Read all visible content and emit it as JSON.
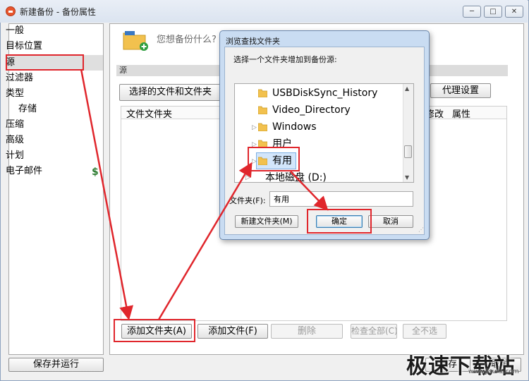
{
  "window": {
    "title": "新建备份 - 备份属性",
    "min_glyph": "─",
    "max_glyph": "□",
    "close_glyph": "✕"
  },
  "nav": {
    "items": [
      {
        "label": "一般",
        "sub": false
      },
      {
        "label": "目标位置",
        "sub": false
      },
      {
        "label": "源",
        "sub": false,
        "selected": true
      },
      {
        "label": "过滤器",
        "sub": false
      },
      {
        "label": "类型",
        "sub": false
      },
      {
        "label": "存储",
        "sub": true
      },
      {
        "label": "压缩",
        "sub": false
      },
      {
        "label": "高级",
        "sub": false
      },
      {
        "label": "计划",
        "sub": false
      },
      {
        "label": "电子邮件",
        "sub": false
      }
    ],
    "dollar": "$"
  },
  "main": {
    "question": "您想备份什么?",
    "section_label": "源",
    "selected_files_btn": "选择的文件和文件夹",
    "proxy_btn": "代理设置",
    "columns": {
      "name": "文件文件夹",
      "modified": "修改",
      "attr": "属性"
    },
    "add_folder_btn": "添加文件夹(A)",
    "add_file_btn": "添加文件(F)",
    "delete_btn": "删除",
    "check_all_btn": "检查全部(C)",
    "uncheck_all_btn": "全不选"
  },
  "footer": {
    "save_run_btn": "保存并运行",
    "save_btn": "保存",
    "cancel_btn": "取消"
  },
  "dialog": {
    "title": "浏览查找文件夹",
    "prompt": "选择一个文件夹增加到备份源:",
    "tree": [
      {
        "label": "USBDiskSync_History",
        "expandable": false
      },
      {
        "label": "Video_Directory",
        "expandable": false
      },
      {
        "label": "Windows",
        "expandable": true
      },
      {
        "label": "用户",
        "expandable": true
      },
      {
        "label": "有用",
        "expandable": true,
        "selected": true
      },
      {
        "label": "本地磁盘 (D:)",
        "expandable": true
      }
    ],
    "folder_label": "文件夹(F):",
    "folder_value": "有用",
    "new_folder_btn": "新建文件夹(M)",
    "ok_btn": "确定",
    "cancel_btn": "取消"
  },
  "colors": {
    "annotation_red": "#e0262c",
    "folder_yellow": "#f2c14e",
    "plus_green": "#2e9e3f"
  },
  "watermark": {
    "brand": "极速下载站",
    "url": "www.jisuxz.com"
  }
}
